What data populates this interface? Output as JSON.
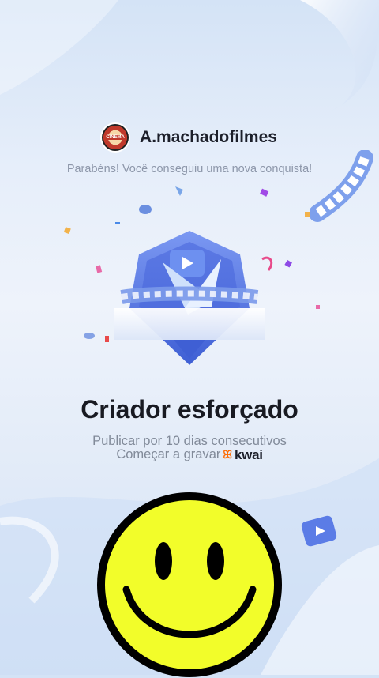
{
  "profile": {
    "avatar_text": "CINEMA",
    "username": "A.machadofilmes"
  },
  "message": {
    "congrats": "Parabéns! Você conseguiu uma nova conquista!"
  },
  "achievement": {
    "title": "Criador esforçado",
    "description": "Publicar por 10 dias consecutivos",
    "cta_label": "Começar a gravar",
    "brand": "kwai"
  },
  "colors": {
    "badge": "#5b78e8",
    "smiley_face": "#f2fd2a",
    "brand_orange": "#ff6a00",
    "confetti_purple": "#a04ae6"
  },
  "icons": [
    "avatar-logo",
    "achievement-badge-icon",
    "film-strip-icon",
    "video-play-icon",
    "kwai-logo-icon",
    "smiley-sticker"
  ]
}
